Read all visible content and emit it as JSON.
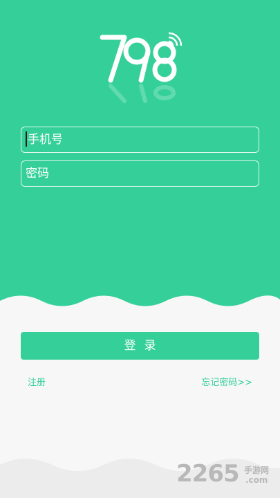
{
  "colors": {
    "primary": "#35d09a",
    "background": "#f7f7f7",
    "link": "#35d09a",
    "watermark": "#b8b8b8"
  },
  "logo": {
    "icon": "798-logo-with-wifi-signal"
  },
  "form": {
    "phone_placeholder": "手机号",
    "password_placeholder": "密码",
    "login_label": "登录"
  },
  "links": {
    "register": "注册",
    "forgot_password": "忘记密码>>"
  },
  "watermark": {
    "number": "2265",
    "site_cn": "手游网",
    "domain": ".com"
  }
}
